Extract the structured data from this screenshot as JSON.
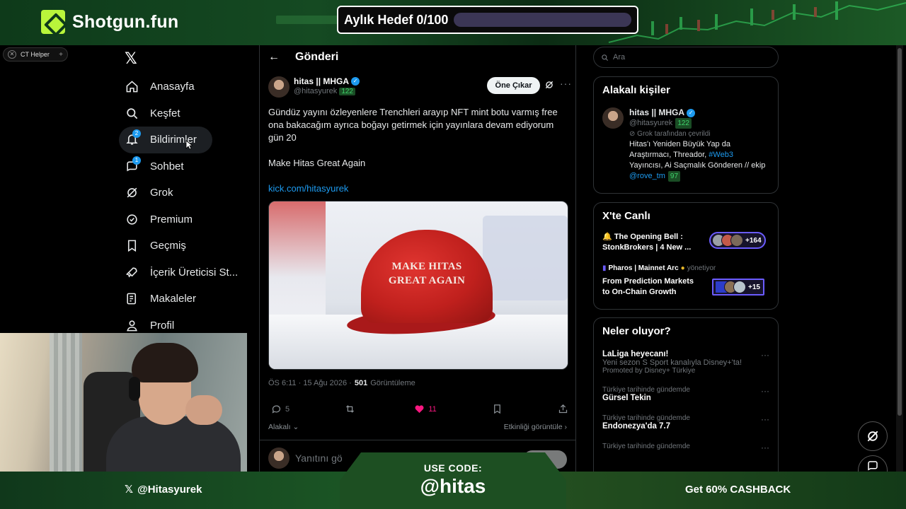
{
  "overlay": {
    "brand": "Shotgun.fun",
    "goal_label": "Aylık Hedef 0/100",
    "goal_progress": 0,
    "use_code_label": "USE CODE:",
    "code": "@hitas",
    "social_handle": "@Hitasyurek",
    "cashback": "Get 60% CASHBACK",
    "accent": "#b9f53b"
  },
  "extension": {
    "label": "CT Helper",
    "plus": "+"
  },
  "nav": {
    "items": [
      {
        "label": "Anasayfa",
        "icon": "home-icon"
      },
      {
        "label": "Keşfet",
        "icon": "search-icon"
      },
      {
        "label": "Bildirimler",
        "icon": "bell-icon",
        "badge": "2"
      },
      {
        "label": "Sohbet",
        "icon": "chat-icon",
        "badge": "1"
      },
      {
        "label": "Grok",
        "icon": "grok-icon"
      },
      {
        "label": "Premium",
        "icon": "premium-icon"
      },
      {
        "label": "Geçmiş",
        "icon": "bookmark-icon"
      },
      {
        "label": "İçerik Üreticisi St...",
        "icon": "rocket-icon"
      },
      {
        "label": "Makaleler",
        "icon": "article-icon"
      },
      {
        "label": "Profil",
        "icon": "profile-icon"
      }
    ]
  },
  "post": {
    "header_title": "Gönderi",
    "author_name": "hitas || MHGA",
    "author_handle": "@hitasyurek",
    "author_score": "122",
    "highlight_label": "Öne Çıkar",
    "text_line1": "Gündüz yayını özleyenlere Trenchleri arayıp NFT mint botu varmış free ona bakacağım ayrıca boğayı getirmek için yayınlara devam ediyorum gün 20",
    "text_line2": "Make Hitas Great Again",
    "link": "kick.com/hitasyurek",
    "image_hat_text_1": "MAKE HITAS",
    "image_hat_text_2": "GREAT AGAIN",
    "timestamp": "ÖS 6:11 · 15 Ağu 2026 ·",
    "views_count": "501",
    "views_label": "Görüntüleme",
    "replies": "5",
    "reposts": "",
    "likes": "11",
    "related_label": "Alakalı",
    "activity_label": "Etkinliği görüntüle",
    "reply_placeholder": "Yanıtını gö"
  },
  "right": {
    "search_placeholder": "Ara",
    "related_people_title": "Alakalı kişiler",
    "rel_name": "hitas || MHGA",
    "rel_handle": "@hitasyurek",
    "rel_score": "122",
    "rel_grok": "Grok tarafından çevrildi",
    "rel_bio_1": "Hitas'ı Yeniden Büyük Yap da",
    "rel_bio_2a": "Araştırmacı, Threador,",
    "rel_bio_tag": "#Web3",
    "rel_bio_3": "Yayıncısı, Ai Saçmalık Gönderen // ekip",
    "rel_mention": "@rove_tm",
    "rel_mention_score": "97",
    "live_title": "X'te Canlı",
    "live1_title": "🔔 The Opening Bell : StonkBrokers | 4 New ...",
    "live1_count": "+164",
    "live2_host": "Pharos | Mainnet Arc",
    "live2_host_sub": "yönetiyor",
    "live2_title": "From Prediction Markets to On-Chain Growth",
    "live2_count": "+15",
    "trends_title": "Neler oluyor?",
    "trends": [
      {
        "top": "",
        "name": "LaLiga heyecanı!",
        "desc": "Yeni sezon S Sport kanalıyla Disney+'ta!",
        "promo": "Promoted by Disney+ Türkiye"
      },
      {
        "top": "Türkiye tarihinde gündemde",
        "name": "Gürsel Tekin",
        "desc": "",
        "promo": ""
      },
      {
        "top": "Türkiye tarihinde gündemde",
        "name": "Endonezya'da 7.7",
        "desc": "",
        "promo": ""
      },
      {
        "top": "Türkiye tarihinde gündemde",
        "name": "",
        "desc": "",
        "promo": ""
      }
    ]
  }
}
